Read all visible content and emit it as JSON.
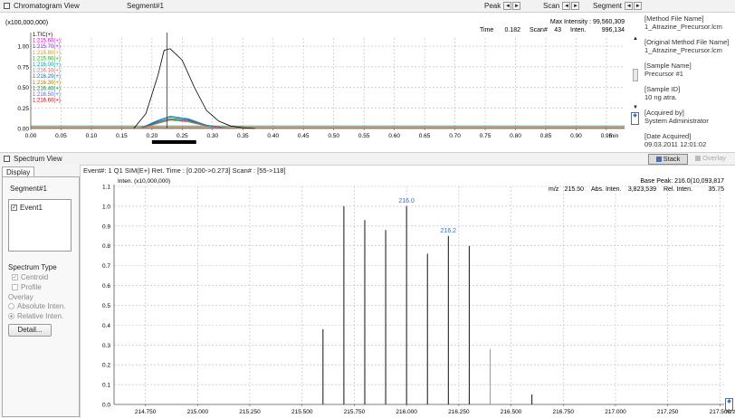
{
  "chromatogram_panel": {
    "title": "Chromatogram View",
    "segment": "Segment#1",
    "peak_label": "Peak",
    "scan_label": "Scan",
    "segment_label": "Segment",
    "y_multiplier": "(x100,000,000)",
    "max_intensity": "Max Intensity : 99,560,309",
    "readout": {
      "time_label": "Time",
      "time": "0.182",
      "scan_label": "Scan#",
      "scan": "43",
      "inten_label": "Inten.",
      "inten": "996,134"
    },
    "legend": [
      "1.TIC(+)",
      "1:215.60(+)",
      "1:215.70(+)",
      "1:215.80(+)",
      "1:215.90(+)",
      "1:216.00(+)",
      "1:216.10(+)",
      "1:216.20(+)",
      "1:216.30(+)",
      "1:216.40(+)",
      "1:216.50(+)",
      "1:216.60(+)"
    ],
    "legend_colors": [
      "#000000",
      "#d400d4",
      "#7030a0",
      "#d4a000",
      "#20a020",
      "#00a0a0",
      "#d46060",
      "#0070c0",
      "#a08000",
      "#008040",
      "#6060d4",
      "#c00000"
    ],
    "y_ticks": [
      "1.00",
      "0.75",
      "0.50",
      "0.25",
      "0.00"
    ],
    "x_ticks": [
      "0.00",
      "0.05",
      "0.10",
      "0.15",
      "0.20",
      "0.25",
      "0.30",
      "0.35",
      "0.40",
      "0.45",
      "0.50",
      "0.55",
      "0.60",
      "0.65",
      "0.70",
      "0.75",
      "0.80",
      "0.85",
      "0.90",
      "0.95"
    ],
    "x_unit": "min"
  },
  "file_info": {
    "method_label": "[Method File Name]",
    "method_value": "1_Atrazine_Precursor.lcm",
    "orig_method_label": "[Original Method File Name]",
    "orig_method_value": "1_Atrazine_Precursor.lcm",
    "sample_name_label": "[Sample Name]",
    "sample_name_value": "Precursor #1",
    "sample_id_label": "[Sample ID]",
    "sample_id_value": "10 ng atra.",
    "acquired_by_label": "[Acquired by]",
    "acquired_by_value": "System Administrator",
    "date_label": "[Date Acquired]",
    "date_value": "09.03.2011 12:01:02"
  },
  "spectrum_panel": {
    "title": "Spectrum View",
    "stack_label": "Stack",
    "overlay_label": "Overlay",
    "display_tab": "Display",
    "segment": "Segment#1",
    "event_item": "Event1",
    "spectrum_type_label": "Spectrum Type",
    "centroid_label": "Centroid",
    "profile_label": "Profile",
    "overlay_section_label": "Overlay",
    "absolute_label": "Absolute Inten.",
    "relative_label": "Relative Inten.",
    "detail_button": "Detail...",
    "header": "Event#: 1 Q1 SIM(E+)  Ret. Time : [0.200->0.273]  Scan# : [55->118]",
    "y_multiplier": "Inten. (x10,000,000)",
    "base_peak": "Base Peak: 216.0(10,093,817",
    "readout": {
      "mz_label": "m/z",
      "mz": "215.50",
      "abs_label": "Abs. Inten.",
      "abs": "3,823,539",
      "rel_label": "Rel. Inten.",
      "rel": "35.75"
    },
    "x_unit": "m/z"
  },
  "chart_data": [
    {
      "type": "line",
      "title": "",
      "xlabel": "min",
      "ylabel": "",
      "xlim": [
        0.0,
        0.98
      ],
      "ylim": [
        0.0,
        1.1
      ],
      "series": [
        {
          "name": "1.TIC(+)",
          "x": [
            0.17,
            0.19,
            0.21,
            0.22,
            0.23,
            0.25,
            0.27,
            0.29,
            0.31,
            0.33,
            0.35,
            0.37
          ],
          "values": [
            0.0,
            0.18,
            0.65,
            0.95,
            0.97,
            0.83,
            0.5,
            0.22,
            0.09,
            0.03,
            0.01,
            0.0
          ]
        },
        {
          "name": "1:216.00(+)",
          "x": [
            0.18,
            0.21,
            0.23,
            0.26,
            0.29,
            0.33
          ],
          "values": [
            0.0,
            0.1,
            0.15,
            0.12,
            0.04,
            0.0
          ]
        },
        {
          "name": "1:216.20(+)",
          "x": [
            0.18,
            0.21,
            0.23,
            0.26,
            0.29,
            0.33
          ],
          "values": [
            0.0,
            0.09,
            0.14,
            0.11,
            0.04,
            0.0
          ]
        },
        {
          "name": "1:215.70(+)",
          "x": [
            0.18,
            0.21,
            0.23,
            0.26,
            0.29,
            0.33
          ],
          "values": [
            0.0,
            0.08,
            0.12,
            0.1,
            0.03,
            0.0
          ]
        },
        {
          "name": "1:215.90(+)",
          "x": [
            0.18,
            0.21,
            0.23,
            0.26,
            0.29,
            0.33
          ],
          "values": [
            0.0,
            0.07,
            0.11,
            0.09,
            0.03,
            0.0
          ]
        },
        {
          "name": "1:216.10(+)",
          "x": [
            0.18,
            0.21,
            0.23,
            0.26,
            0.29,
            0.33
          ],
          "values": [
            0.0,
            0.06,
            0.1,
            0.08,
            0.03,
            0.0
          ]
        }
      ],
      "cursor_x": 0.225,
      "selected_range": [
        0.2,
        0.273
      ]
    },
    {
      "type": "bar",
      "title": "",
      "xlabel": "m/z",
      "ylabel": "Inten. (x10,000,000)",
      "xlim": [
        214.6,
        217.52
      ],
      "ylim": [
        0.0,
        1.1
      ],
      "x_ticks": [
        "214.750",
        "215.000",
        "215.250",
        "215.500",
        "215.750",
        "216.000",
        "216.250",
        "216.500",
        "216.750",
        "217.000",
        "217.250",
        "217.500"
      ],
      "y_ticks": [
        "0.0",
        "0.1",
        "0.2",
        "0.3",
        "0.4",
        "0.5",
        "0.6",
        "0.7",
        "0.8",
        "0.9",
        "1.0",
        "1.1"
      ],
      "peaks": [
        {
          "mz": 215.6,
          "value": 0.38
        },
        {
          "mz": 215.7,
          "value": 1.0
        },
        {
          "mz": 215.8,
          "value": 0.93
        },
        {
          "mz": 215.9,
          "value": 0.88
        },
        {
          "mz": 216.0,
          "value": 1.0,
          "label": "216.0"
        },
        {
          "mz": 216.1,
          "value": 0.76
        },
        {
          "mz": 216.2,
          "value": 0.85,
          "label": "216.2"
        },
        {
          "mz": 216.3,
          "value": 0.8
        },
        {
          "mz": 216.4,
          "value": 0.28
        },
        {
          "mz": 216.6,
          "value": 0.05
        }
      ]
    }
  ]
}
